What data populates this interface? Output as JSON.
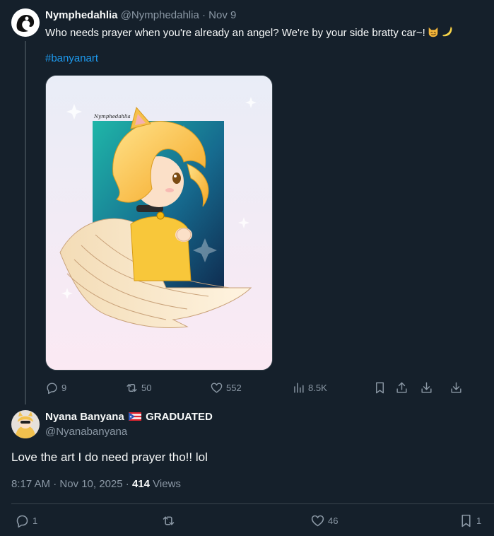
{
  "tweet": {
    "author_name": "Nymphedahlia",
    "author_handle": "@Nymphedahlia",
    "separator": "·",
    "date": "Nov 9",
    "text": "Who needs prayer when you're already an angel? We're by your side bratty car~!",
    "emojis": [
      "smirking-cat-emoji",
      "banana-emoji"
    ],
    "hashtag": "#banyanart",
    "media": {
      "alt": "Anime-style illustration of a blonde cat-eared girl with angel wings and a bell collar, praying",
      "signature": "Nymphedahlia"
    },
    "actions": {
      "replies": "9",
      "reposts": "50",
      "likes": "552",
      "views": "8.5K"
    }
  },
  "reply": {
    "author_name": "Nyana Banyana",
    "author_suffix": "GRADUATED",
    "author_handle": "@Nyanabanyana",
    "text": "Love the art I do need prayer tho!! lol",
    "time": "8:17 AM · Nov 10, 2025",
    "meta_sep": "·",
    "views_count": "414",
    "views_label": "Views",
    "actions": {
      "replies": "1",
      "reposts": "",
      "likes": "46",
      "bookmarks": "1"
    }
  },
  "colors": {
    "background": "#15202b",
    "text": "#f7f9f9",
    "muted": "#8b98a5",
    "link": "#1d9bf0",
    "border": "#38444d"
  }
}
